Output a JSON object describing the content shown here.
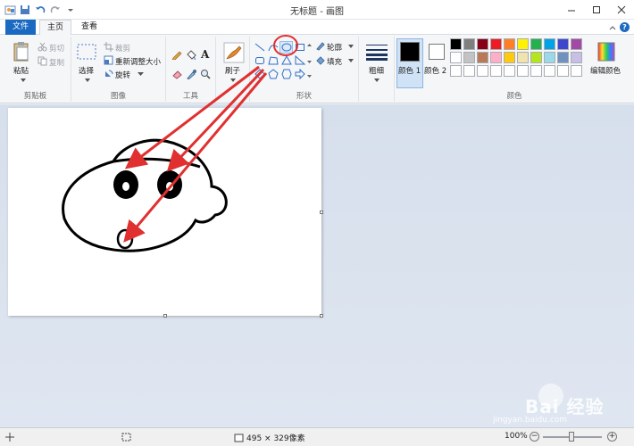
{
  "window": {
    "title": "无标题 - 画图",
    "colors": {
      "accent": "#1b6ac2",
      "annotation": "#e03030"
    }
  },
  "tabs": {
    "file": "文件",
    "home": "主页",
    "view": "查看"
  },
  "clipboard": {
    "paste": "粘贴",
    "cut": "剪切",
    "copy": "复制",
    "group": "剪贴板"
  },
  "image": {
    "select": "选择",
    "crop": "裁剪",
    "resize": "重新调整大小",
    "rotate": "旋转",
    "group": "图像"
  },
  "tools": {
    "group": "工具"
  },
  "brushes": {
    "label": "刷子"
  },
  "shapes": {
    "outline": "轮廓",
    "fill": "填充",
    "group": "形状"
  },
  "size": {
    "label": "粗细"
  },
  "colors": {
    "color1": "颜色 1",
    "color2": "颜色 2",
    "edit": "编辑颜色",
    "group": "颜色",
    "color1_value": "#000000",
    "color2_value": "#ffffff",
    "palette_row1": [
      "#000000",
      "#7f7f7f",
      "#880015",
      "#ed1c24",
      "#ff7f27",
      "#fff200",
      "#22b14c",
      "#00a2e8",
      "#3f48cc",
      "#a349a4"
    ],
    "palette_row2": [
      "#ffffff",
      "#c3c3c3",
      "#b97a57",
      "#ffaec9",
      "#ffc90e",
      "#efe4b0",
      "#b5e61d",
      "#99d9ea",
      "#7092be",
      "#c8bfe7"
    ],
    "palette_row3": [
      "#ffffff",
      "#ffffff",
      "#ffffff",
      "#ffffff",
      "#ffffff",
      "#ffffff",
      "#ffffff",
      "#ffffff",
      "#ffffff",
      "#ffffff"
    ]
  },
  "status": {
    "dimensions": "495 × 329像素",
    "zoom": "100%"
  },
  "watermark": {
    "text": "Bai 经验",
    "url": "jingyan.baidu.com"
  }
}
